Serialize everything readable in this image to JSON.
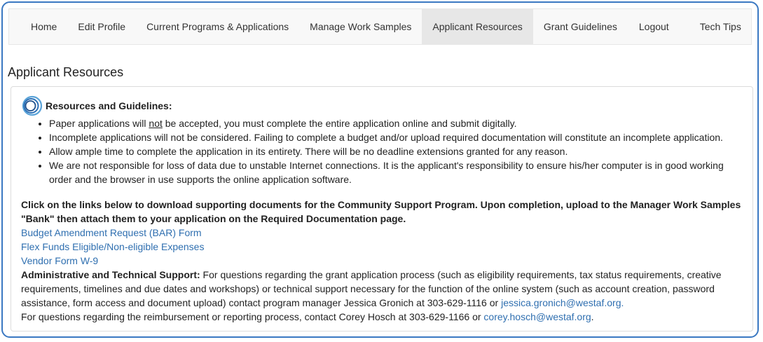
{
  "nav": {
    "items": [
      {
        "label": "Home",
        "active": false
      },
      {
        "label": "Edit Profile",
        "active": false
      },
      {
        "label": "Current Programs & Applications",
        "active": false
      },
      {
        "label": "Manage Work Samples",
        "active": false
      },
      {
        "label": "Applicant Resources",
        "active": true
      },
      {
        "label": "Grant Guidelines",
        "active": false
      },
      {
        "label": "Logout",
        "active": false
      },
      {
        "label": "Tech Tips",
        "active": false
      }
    ]
  },
  "page": {
    "title": "Applicant Resources"
  },
  "resources": {
    "heading": "Resources and Guidelines:",
    "rule1_pre": "Paper applications will ",
    "rule1_underlined": "not",
    "rule1_post": " be accepted, you must complete the entire application online and submit digitally.",
    "rule2": "Incomplete applications will not be considered. Failing to complete a budget and/or upload required documentation will constitute an incomplete application.",
    "rule3": "Allow ample time to complete the application in its entirety. There will be no deadline extensions granted for any reason.",
    "rule4": "We are not responsible for loss of data due to unstable Internet connections. It is the applicant's responsibility to ensure his/her computer is in good working order and the browser in use supports the online application software."
  },
  "instructions": "Click on the links below to download supporting documents for the Community Support Program. Upon completion, upload to the Manager Work Samples \"Bank\" then attach them to your application on the Required Documentation page.",
  "links": [
    "Budget Amendment Request (BAR) Form",
    "Flex Funds Eligible/Non-eligible Expenses",
    "Vendor Form W-9"
  ],
  "support": {
    "label": "Administrative and Technical Support:",
    "text": " For questions regarding the grant application process (such as eligibility requirements, tax status requirements, creative requirements, timelines and due dates and workshops) or technical support necessary for the function of the online system (such as account creation, password assistance, form access and document upload) contact program manager Jessica Gronich at 303-629-1116 or ",
    "email1": "jessica.gronich@westaf.org.",
    "line2": "For questions regarding the reimbursement or reporting process, contact Corey Hosch at 303-629-1166 or ",
    "email2": "corey.hosch@westaf.org",
    "line2_end": "."
  },
  "colors": {
    "accent": "#3a78c2",
    "link": "#2f6fb0",
    "active_tab": "#e7e7e7"
  },
  "icons": {
    "logo": "concentric-circles-logo"
  }
}
